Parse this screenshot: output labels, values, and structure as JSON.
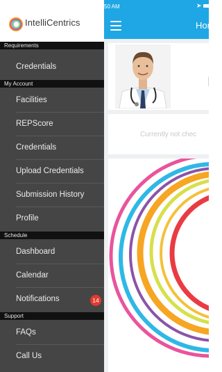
{
  "status_bar": {
    "time": "50 AM"
  },
  "app_bar": {
    "title": "Hom"
  },
  "checkin": {
    "text": "Currently not chec"
  },
  "logo": {
    "text": "IntelliCentrics"
  },
  "drawer": {
    "sections": {
      "requirements": "Requirements",
      "my_account": "My Account",
      "schedule": "Schedule",
      "support": "Support"
    },
    "items": {
      "credentials_req": "Credentials",
      "facilities": "Facilities",
      "repscore": "REPScore",
      "credentials": "Credentials",
      "upload_credentials": "Upload Credentials",
      "submission_history": "Submission History",
      "profile": "Profile",
      "dashboard": "Dashboard",
      "calendar": "Calendar",
      "notifications": "Notifications",
      "faqs": "FAQs",
      "call_us": "Call Us"
    },
    "notifications_count": "14"
  },
  "colors": {
    "accent": "#1ea7e4",
    "drawer_bg": "#454545",
    "section_bg": "#111111",
    "badge": "#e23a2e"
  },
  "icons": [
    "hamburger-menu-icon",
    "location-arrow-icon",
    "battery-icon",
    "logo-ring-icon",
    "colored-rings-graphic"
  ]
}
